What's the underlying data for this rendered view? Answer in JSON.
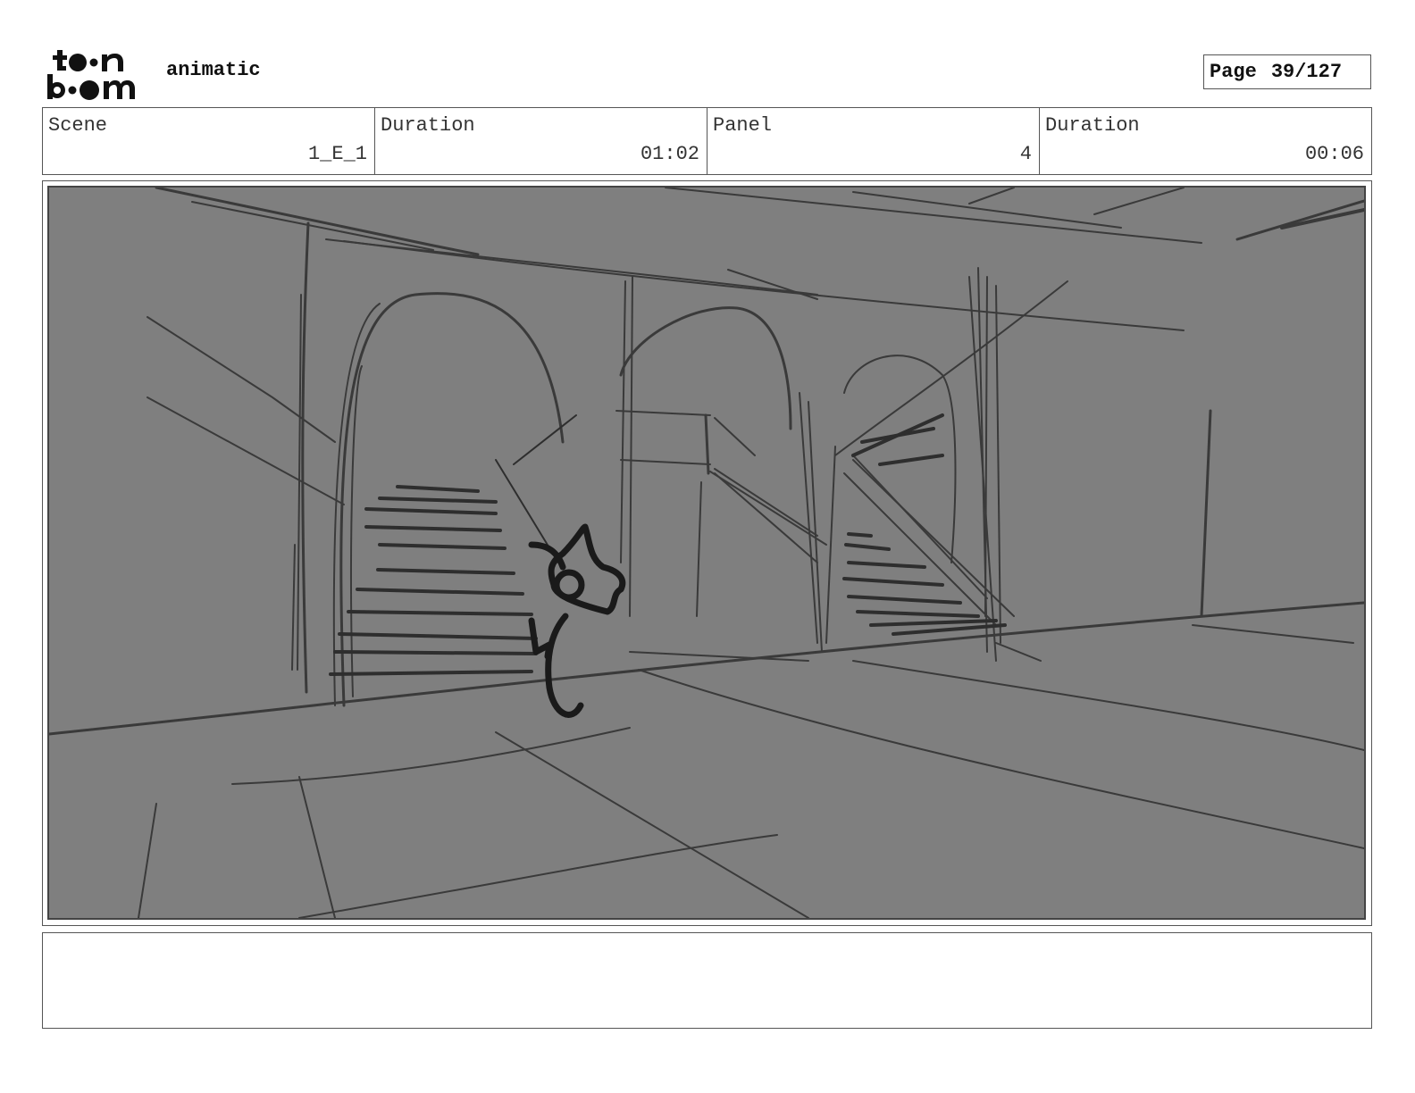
{
  "header": {
    "logo": {
      "name": "toon-boom-logo",
      "line1": "to•n",
      "line2": "b•om"
    },
    "project_title": "animatic",
    "page": {
      "label": "Page",
      "value": "39/127"
    }
  },
  "info": {
    "scene_label": "Scene",
    "scene_value": "1_E_1",
    "scene_duration_label": "Duration",
    "scene_duration_value": "01:02",
    "panel_label": "Panel",
    "panel_value": "4",
    "panel_duration_label": "Duration",
    "panel_duration_value": "00:06"
  },
  "panel": {
    "background_color": "#7f7f7f",
    "stroke_color": "#3a3a3a",
    "ink_color": "#1a1a1a"
  },
  "notes": {
    "text": ""
  }
}
